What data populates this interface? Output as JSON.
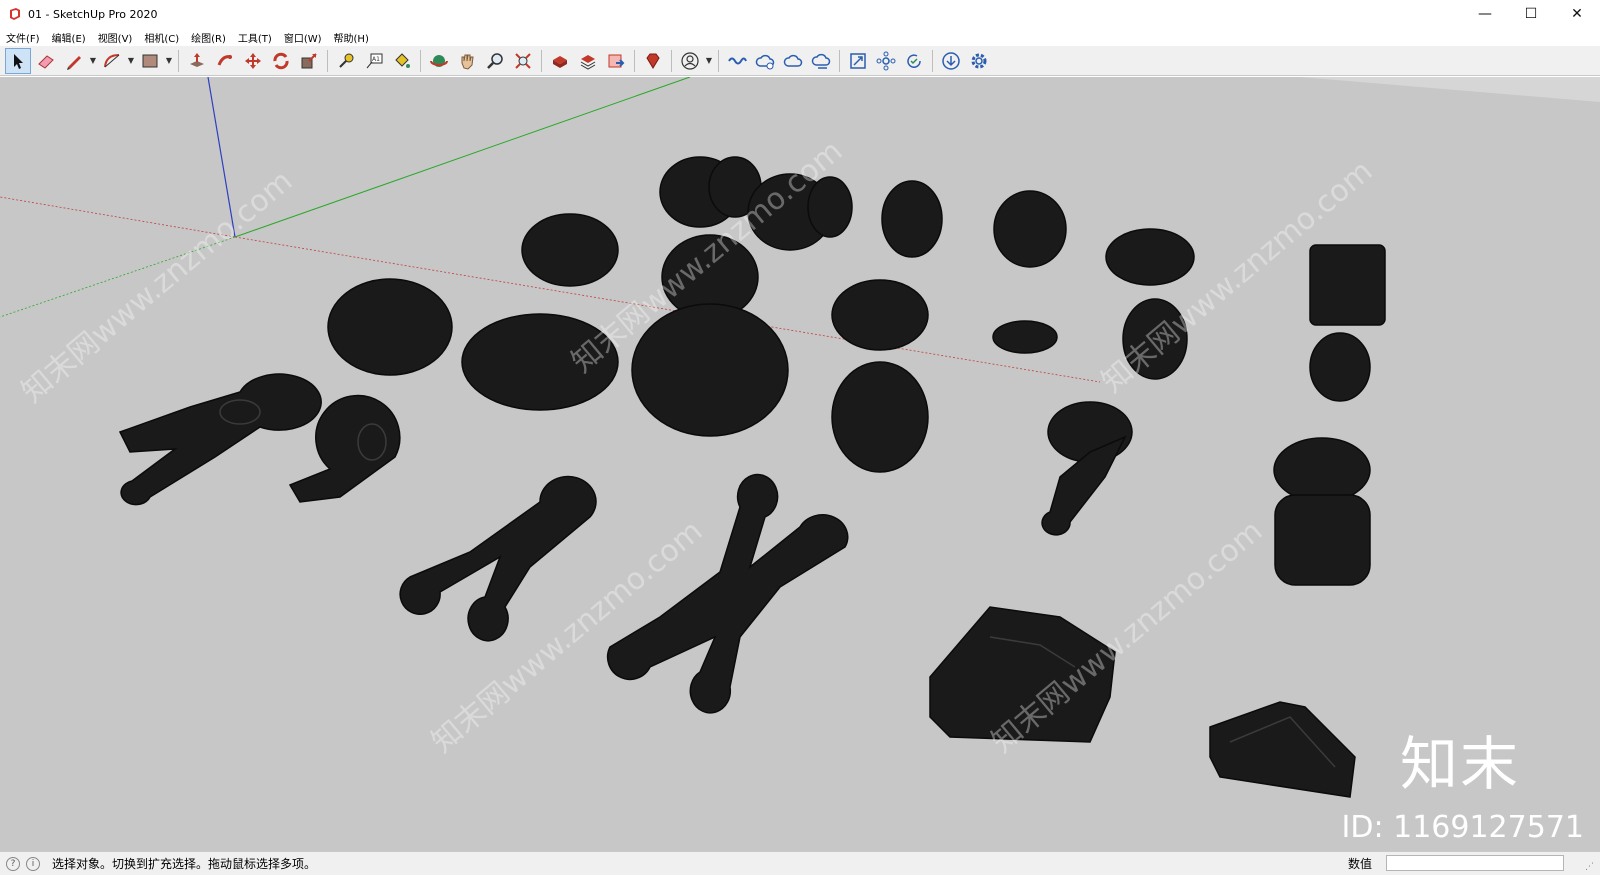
{
  "window": {
    "title": "01 - SketchUp Pro 2020",
    "minimize": "—",
    "maximize": "☐",
    "close": "✕"
  },
  "menu": [
    "文件(F)",
    "编辑(E)",
    "视图(V)",
    "相机(C)",
    "绘图(R)",
    "工具(T)",
    "窗口(W)",
    "帮助(H)"
  ],
  "toolbar": {
    "tools": [
      "select-tool",
      "eraser-tool",
      "line-tool",
      "arc-tool",
      "rectangle-tool",
      "push-pull-tool",
      "follow-me-tool",
      "move-tool",
      "rotate-tool",
      "scale-tool",
      "tape-measure-tool",
      "text-tool",
      "paint-bucket-tool",
      "orbit-tool",
      "pan-tool",
      "zoom-tool",
      "zoom-extents-tool",
      "warehouse-tool",
      "extension-warehouse-tool",
      "send-to-layout-tool",
      "ruby-console-tool",
      "account-tool",
      "trimble-connect-tool",
      "cloud-sync-tool",
      "cloud-open-tool",
      "cloud-share-tool",
      "section-tool",
      "components-tool",
      "update-tool",
      "download-tool",
      "settings-tool"
    ]
  },
  "viewport": {
    "background": "#c7c7c7",
    "model_color": "#1a1a1a",
    "watermark_text": "知末网www.znzmo.com",
    "brand_logo": "知末",
    "brand_id": "ID: 1169127571"
  },
  "status": {
    "hint": "选择对象。切换到扩充选择。拖动鼠标选择多项。",
    "measure_label": "数值",
    "measure_value": ""
  }
}
